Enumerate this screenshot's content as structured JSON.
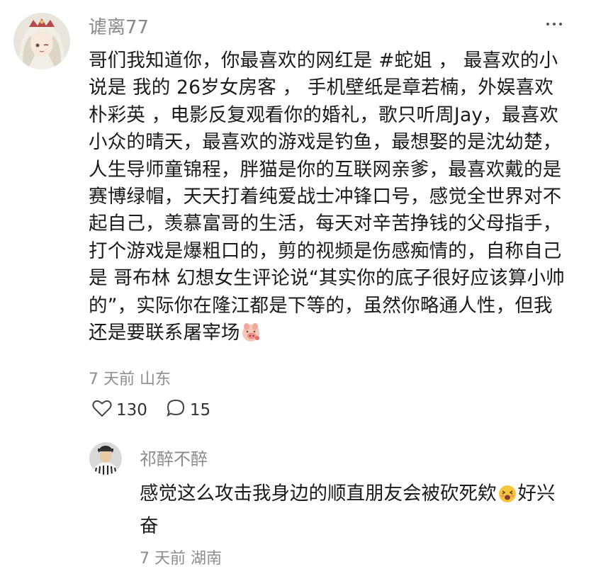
{
  "comment": {
    "username": "谑离77",
    "text": "哥们我知道你，你最喜欢的网红是 #蛇姐 ， 最喜欢的小说是 我的 26岁女房客 ， 手机壁纸是章若楠，外娱喜欢朴彩英 ，电影反复观看你的婚礼，歌只听周Jay，最喜欢小众的晴天，最喜欢的游戏是钓鱼，最想娶的是沈幼楚，人生导师童锦程，胖猫是你的互联网亲爹，最喜欢戴的是赛博绿帽，天天打着纯爱战士冲锋口号，感觉全世界对不起自己，羡慕富哥的生活，每天对辛苦挣钱的父母指手，打个游戏是爆粗口的，剪的视频是伤感痴情的，自称自己是 哥布林 幻想女生评论说“其实你的底子很好应该算小帅的”，实际你在隆江都是下等的，虽然你略通人性，但我还是要联系屠宰场",
    "emoji": "pig-face-emoji",
    "time": "7 天前",
    "location": "山东",
    "likes": "130",
    "replies": "15"
  },
  "reply": {
    "username": "祁醉不醉",
    "text": "感觉这么攻击我身边的顺直朋友会被砍死欸",
    "emoji": "excited-face-emoji",
    "text_after": "好兴奋",
    "time": "7 天前",
    "location": "湖南"
  },
  "icons": {
    "more": "more-options-icon",
    "like": "heart-icon",
    "reply": "comment-bubble-icon"
  },
  "colors": {
    "meta": "#8d8d8d",
    "text": "#1a1a1a"
  }
}
